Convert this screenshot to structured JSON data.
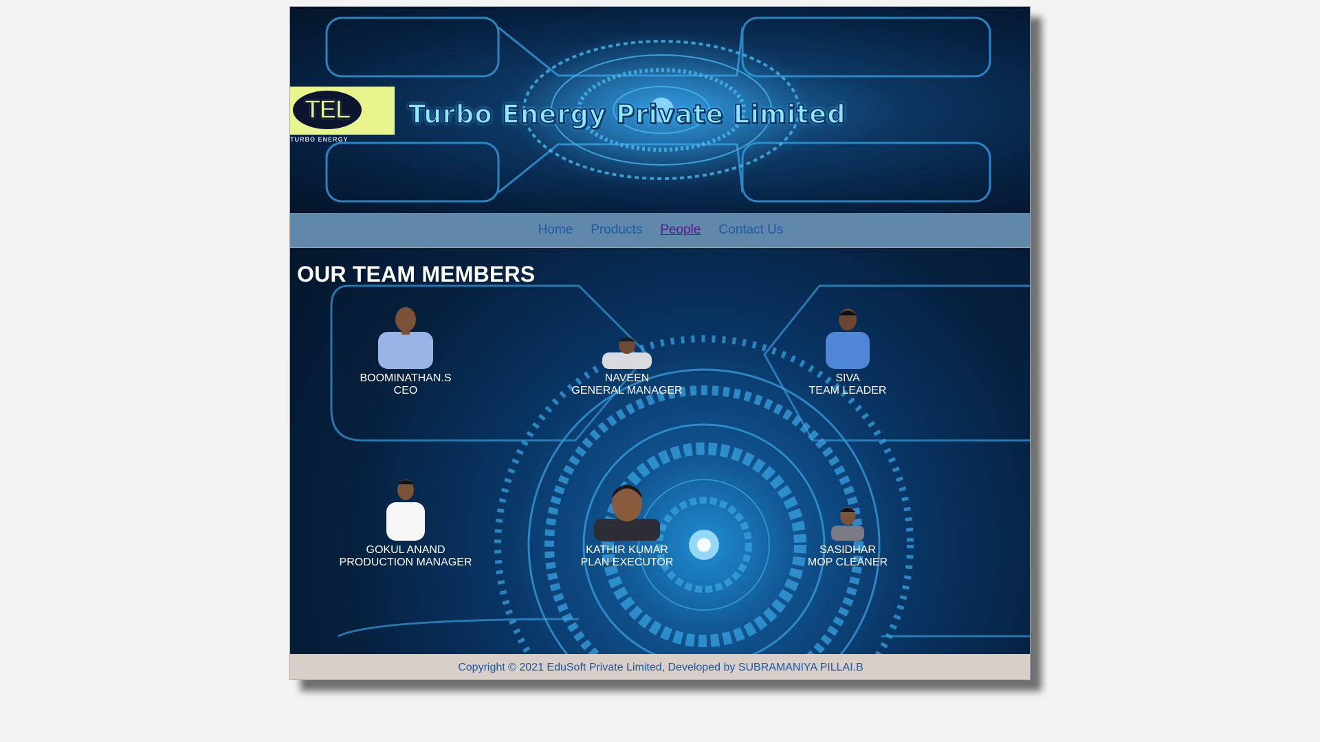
{
  "banner": {
    "logo_text": "TEL",
    "logo_subtext": "TURBO ENERGY",
    "title": "Turbo Energy Private Limited"
  },
  "nav": {
    "items": [
      {
        "label": "Home",
        "active": false
      },
      {
        "label": "Products",
        "active": false
      },
      {
        "label": "People",
        "active": true
      },
      {
        "label": "Contact Us",
        "active": false
      }
    ]
  },
  "team": {
    "title": "OUR TEAM MEMBERS",
    "members": [
      {
        "name": "BOOMINATHAN.S",
        "role": "CEO",
        "shirt": "#9bb4e6"
      },
      {
        "name": "NAVEEN",
        "role": "GENERAL MANAGER",
        "shirt": "#d9dbe0"
      },
      {
        "name": "SIVA",
        "role": "TEAM LEADER",
        "shirt": "#4f86d6"
      },
      {
        "name": "GOKUL ANAND",
        "role": "PRODUCTION MANAGER",
        "shirt": "#f7f7f7"
      },
      {
        "name": "KATHIR KUMAR",
        "role": "PLAN EXECUTOR",
        "shirt": "#2d2d35"
      },
      {
        "name": "SASIDHAR",
        "role": "MOP CLEANER",
        "shirt": "#7a7a86"
      }
    ]
  },
  "footer": {
    "text": "Copyright © 2021 EduSoft Private Limited, Developed by SUBRAMANIYA PILLAI.B"
  },
  "colors": {
    "nav_bg": "#5f88aa",
    "nav_link": "#1f57a3",
    "nav_active": "#551a8b",
    "footer_bg": "#d8d0c8",
    "banner_title": "#8fe8ff"
  }
}
